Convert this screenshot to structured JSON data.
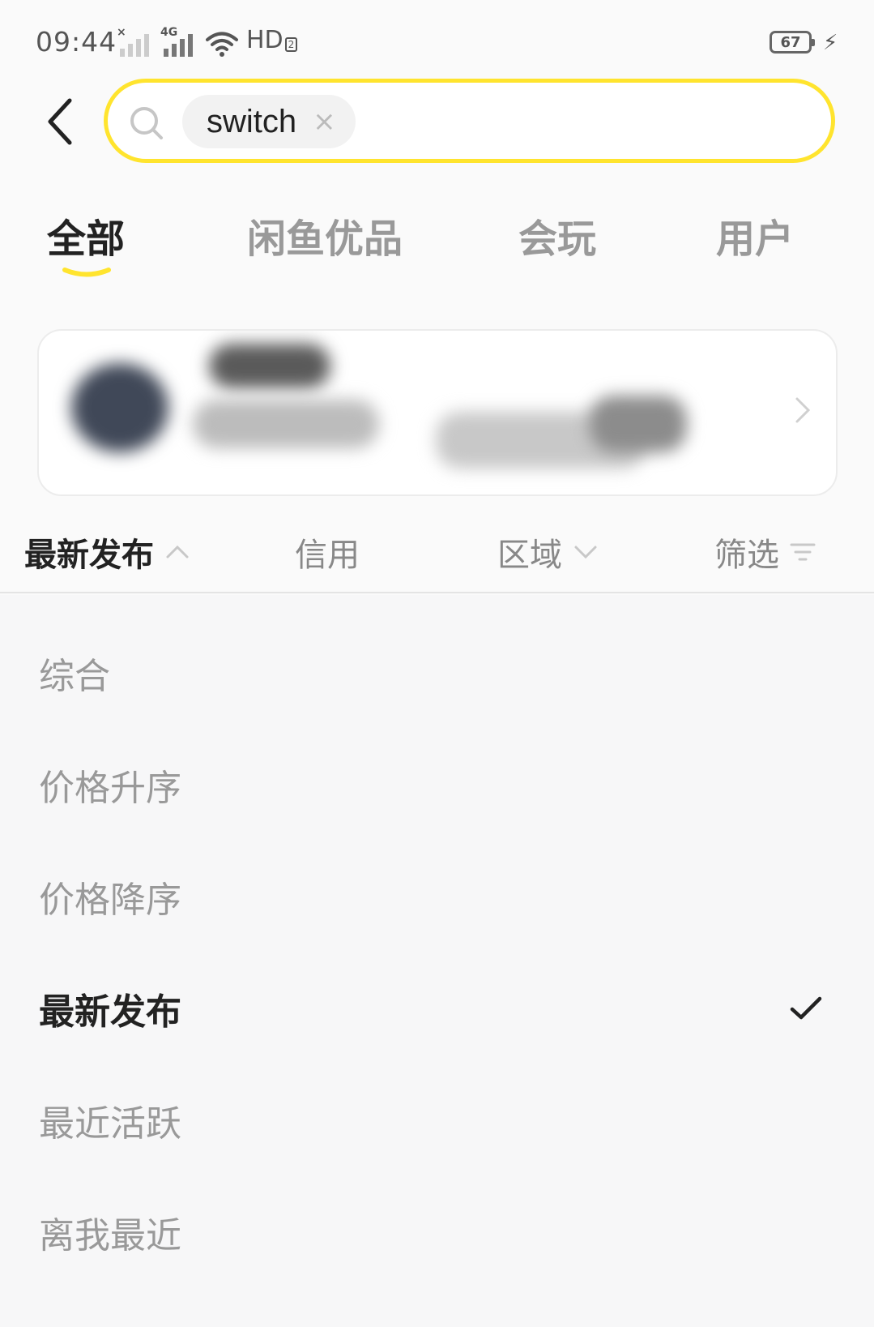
{
  "status_bar": {
    "time": "09:44",
    "network_label": "4G",
    "hd_label": "HD",
    "hd_sub": "2",
    "battery": "67",
    "icons": [
      "signal-icon",
      "signal-4g-icon",
      "wifi-icon",
      "battery-icon",
      "charging-icon"
    ]
  },
  "search": {
    "query": "switch",
    "clear_symbol": "×",
    "border_color": "#ffe42e"
  },
  "tabs": [
    {
      "label": "全部",
      "active": true
    },
    {
      "label": "闲鱼优品",
      "active": false
    },
    {
      "label": "会玩",
      "active": false
    },
    {
      "label": "用户",
      "active": false
    }
  ],
  "sort_bar": {
    "items": [
      {
        "label": "最新发布",
        "active": true,
        "icon": "chevron-up-icon"
      },
      {
        "label": "信用",
        "active": false
      },
      {
        "label": "区域",
        "active": false,
        "icon": "chevron-down-icon"
      },
      {
        "label": "筛选",
        "active": false,
        "icon": "filter-icon"
      }
    ]
  },
  "sort_options": [
    {
      "label": "综合",
      "selected": false
    },
    {
      "label": "价格升序",
      "selected": false
    },
    {
      "label": "价格降序",
      "selected": false
    },
    {
      "label": "最新发布",
      "selected": true
    },
    {
      "label": "最近活跃",
      "selected": false
    },
    {
      "label": "离我最近",
      "selected": false
    }
  ],
  "colors": {
    "accent_yellow": "#ffe42e",
    "text_primary": "#222222",
    "text_secondary": "#999999"
  }
}
